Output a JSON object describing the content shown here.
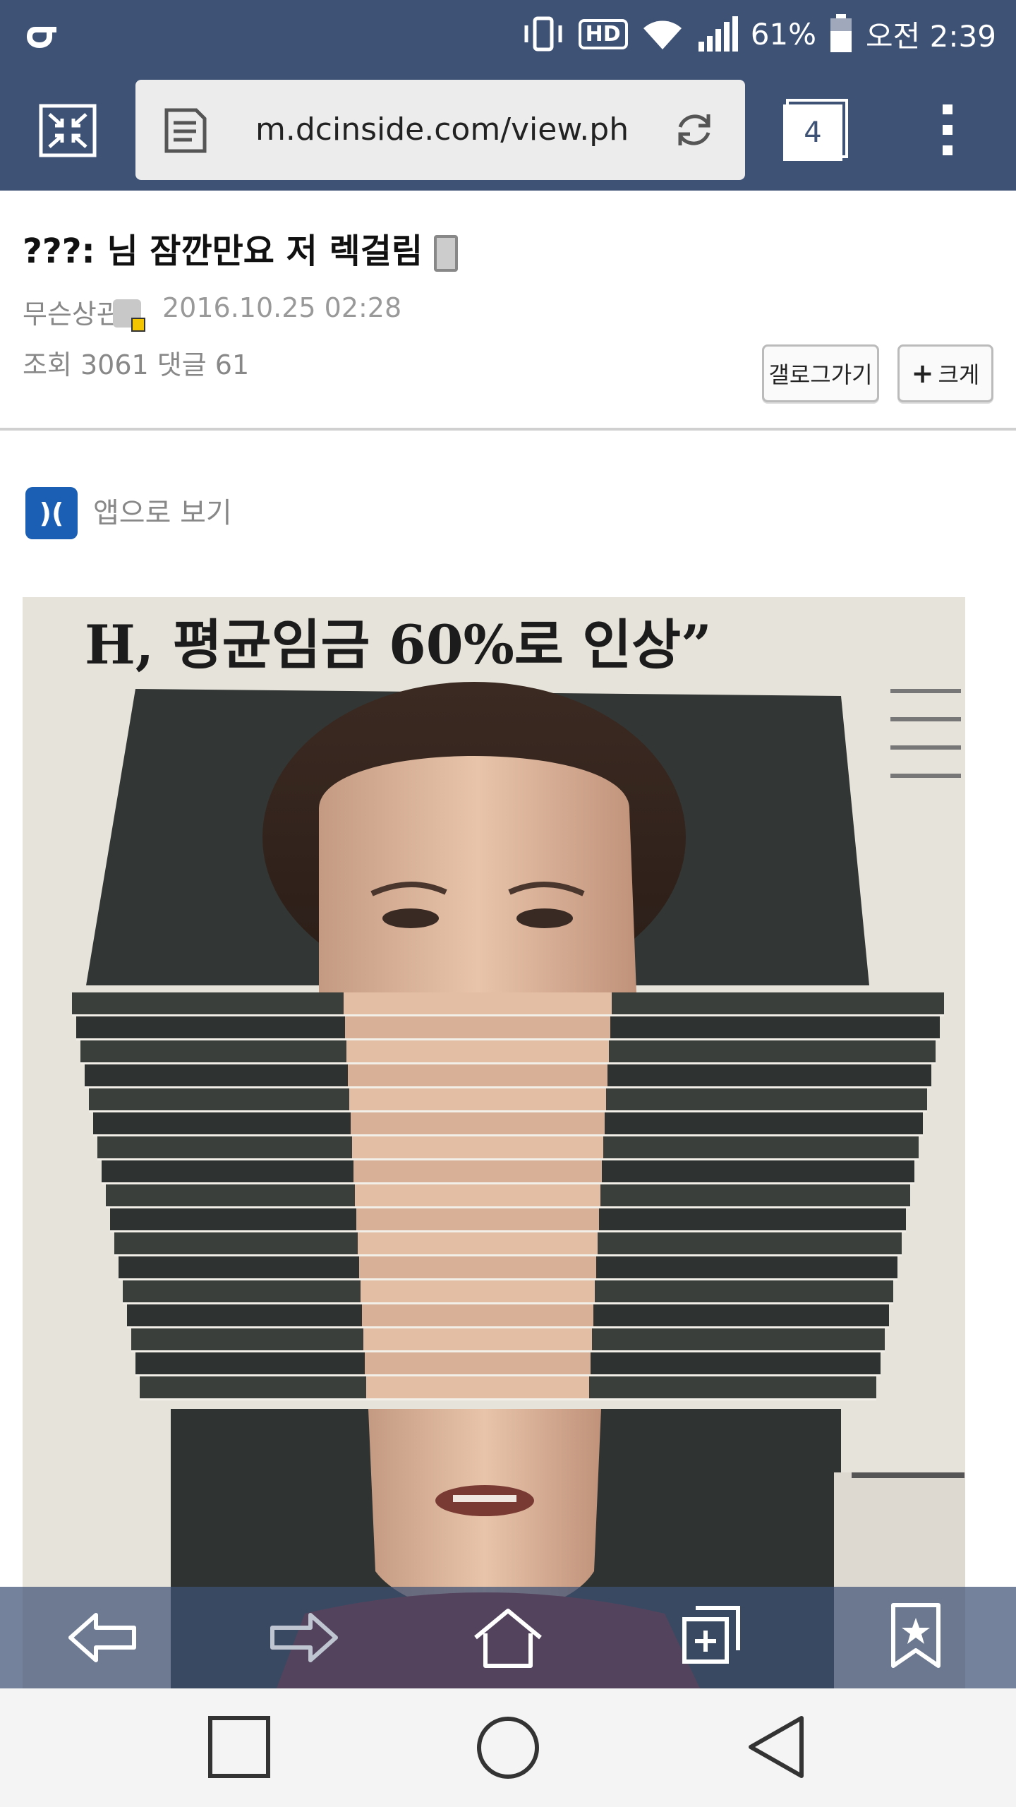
{
  "status_bar": {
    "battery": "61%",
    "time": "오전 2:39",
    "hd_label": "HD"
  },
  "browser": {
    "url": "m.dcinside.com/view.php?id",
    "tab_count": "4"
  },
  "post": {
    "title": "???: 님 잠깐만요 저 렉걸림",
    "author": "무슨상관",
    "datetime": "2016.10.25 02:28",
    "stats": "조회 3061  댓글 61",
    "gallog_button": "갤로그가기",
    "big_button": "크게"
  },
  "app_view": {
    "logo": ")(",
    "label": "앱으로 보기"
  },
  "photo": {
    "headline": "H, 평균임금 60%로 인상”"
  },
  "colors": {
    "bar": "#3e5276",
    "nav_bg": "#f4f4f4"
  }
}
